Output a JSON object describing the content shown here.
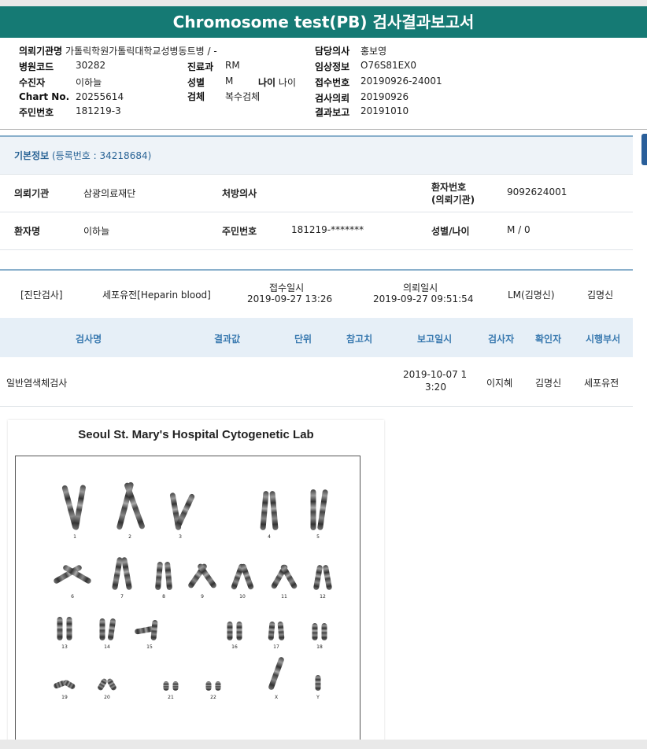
{
  "report": {
    "title": "Chromosome test(PB) 검사결과보고서",
    "left": [
      {
        "label": "의뢰기관명",
        "value": "가톨릭학원가톨릭대학교성병동트병 / -"
      },
      {
        "label": "병원코드",
        "value": "30282"
      },
      {
        "label": "수진자",
        "value": "이하늘"
      },
      {
        "label": "Chart No.",
        "value": "20255614"
      },
      {
        "label": "주민번호",
        "value": "181219-3"
      }
    ],
    "mid": [
      {
        "label": "진료과",
        "value": "RM"
      },
      {
        "label": "성별",
        "value": "M"
      },
      {
        "label": "검체",
        "value": "복수검체"
      }
    ],
    "age": {
      "label": "나이",
      "value": "나이"
    },
    "right": [
      {
        "label": "담당의사",
        "value": "홍보영"
      },
      {
        "label": "임상정보",
        "value": "O76S81EX0"
      },
      {
        "label": "접수번호",
        "value": "20190926-24001"
      },
      {
        "label": "검사의뢰",
        "value": "20190926"
      },
      {
        "label": "결과보고",
        "value": "20191010"
      }
    ]
  },
  "basic": {
    "title": "기본정보",
    "reg": "(등록번호 : 34218684)",
    "rows": [
      {
        "c1_label": "의뢰기관",
        "c1_value": "삼광의료재단",
        "c2_label": "처방의사",
        "c2_value": "",
        "c3_label": "환자번호\n(의뢰기관)",
        "c3_label_1": "환자번호",
        "c3_label_2": "(의뢰기관)",
        "c3_value": "9092624001"
      },
      {
        "c1_label": "환자명",
        "c1_value": "이하늘",
        "c2_label": "주민번호",
        "c2_value": "181219-*******",
        "c3_label_1": "성별/나이",
        "c3_value": "M / 0"
      }
    ]
  },
  "diag": {
    "type": "[진단검사]",
    "dept": "세포유전[Heparin blood]",
    "received_label": "접수일시",
    "received": "2019-09-27 13:26",
    "requested_label": "의뢰일시",
    "requested": "2019-09-27 09:51:54",
    "doctor": "LM(김명신)",
    "doctor2": "김명신"
  },
  "table": {
    "headers": [
      "검사명",
      "결과값",
      "단위",
      "참고치",
      "보고일시",
      "검사자",
      "확인자",
      "시행부서"
    ],
    "row": {
      "name": "일반염색체검사",
      "report_date_1": "2019-10-07 1",
      "report_date_2": "3:20",
      "tester": "이지혜",
      "checker": "김명신",
      "dept": "세포유전"
    }
  },
  "karyotype": {
    "title": "Seoul St. Mary's Hospital Cytogenetic Lab",
    "labels": [
      "1",
      "2",
      "3",
      "4",
      "5",
      "6",
      "7",
      "8",
      "9",
      "10",
      "11",
      "12",
      "13",
      "14",
      "15",
      "16",
      "17",
      "18",
      "19",
      "20",
      "21",
      "22",
      "X",
      "Y"
    ]
  }
}
